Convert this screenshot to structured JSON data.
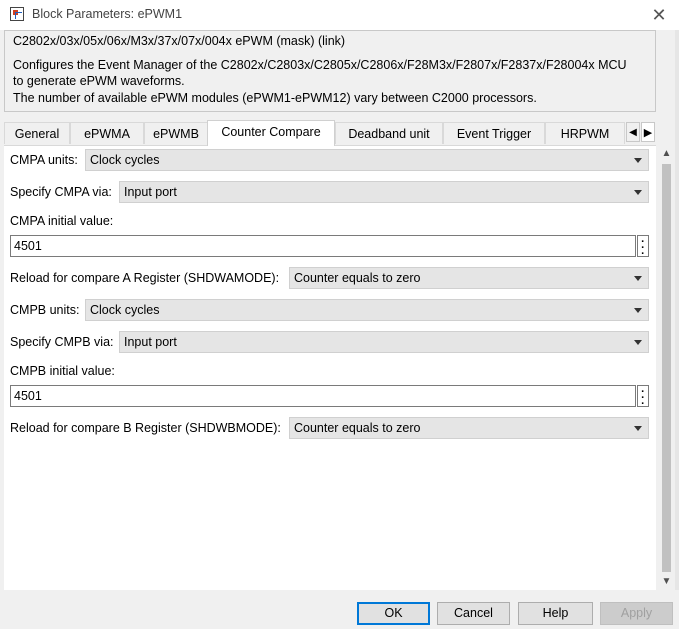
{
  "window": {
    "title": "Block Parameters: ePWM1",
    "close_glyph": "✕"
  },
  "mask": {
    "group_title": "C2802x/03x/05x/06x/M3x/37x/07x/004x ePWM (mask) (link)",
    "description_lines": [
      "Configures the Event Manager of the C2802x/C2803x/C2805x/C2806x/F28M3x/F2807x/F2837x/F28004x MCU",
      "to generate ePWM waveforms.",
      "The number of available ePWM modules (ePWM1-ePWM12) vary between C2000 processors."
    ]
  },
  "tabs": [
    {
      "label": "General"
    },
    {
      "label": "ePWMA"
    },
    {
      "label": "ePWMB"
    },
    {
      "label": "Counter Compare",
      "active": true
    },
    {
      "label": "Deadband unit"
    },
    {
      "label": "Event Trigger"
    },
    {
      "label": "HRPWM"
    }
  ],
  "tab_scroll": {
    "left_icon": "chevron-left-icon",
    "right_icon": "chevron-right-icon"
  },
  "fields": {
    "cmpa_units": {
      "label": "CMPA units:",
      "value": "Clock cycles"
    },
    "cmpa_via": {
      "label": "Specify CMPA via:",
      "value": "Input port"
    },
    "cmpa_initial": {
      "label": "CMPA initial value:",
      "value": "4501"
    },
    "reload_a": {
      "label": "Reload for compare A Register (SHDWAMODE):",
      "value": "Counter equals to zero"
    },
    "cmpb_units": {
      "label": "CMPB units:",
      "value": "Clock cycles"
    },
    "cmpb_via": {
      "label": "Specify CMPB via:",
      "value": "Input port"
    },
    "cmpb_initial": {
      "label": "CMPB initial value:",
      "value": "4501"
    },
    "reload_b": {
      "label": "Reload for compare B Register (SHDWBMODE):",
      "value": "Counter equals to zero"
    }
  },
  "buttons": {
    "ok": "OK",
    "cancel": "Cancel",
    "help": "Help",
    "apply": "Apply"
  },
  "colors": {
    "accent": "#0078d7",
    "window_bg": "#f0f0f0",
    "panel_bg": "#ffffff"
  }
}
